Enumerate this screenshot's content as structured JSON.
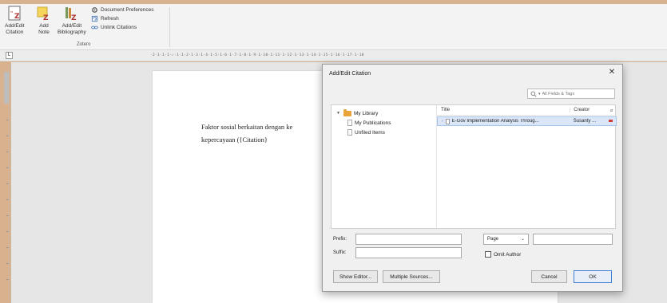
{
  "ribbon": {
    "add_edit_citation": [
      "Add/Edit",
      "Citation"
    ],
    "add_note": [
      "Add",
      "Note"
    ],
    "add_edit_bibliography": [
      "Add/Edit",
      "Bibliography"
    ],
    "document_preferences": "Document Preferences",
    "refresh": "Refresh",
    "unlink_citations": "Unlink Citations",
    "group_label": "Zotero"
  },
  "ruler": {
    "tab_selector": "L",
    "ticks": "·2·1·1·1·✓·1·1·2·1·3·1·4·1·5·1·6·1·7·1·8·1·9·1·10·1·11·1·12·1·13·1·14·1·15·1·16·1·17·1·18"
  },
  "document": {
    "line1": "Faktor sosial berkaitan dengan ke",
    "line2": "kepercayaan ({Citation}"
  },
  "dialog": {
    "title": "Add/Edit Citation",
    "close": "✕",
    "search_placeholder": "All Fields & Tags",
    "tree": {
      "root": "My Library",
      "children": [
        "My Publications",
        "Unfiled Items"
      ]
    },
    "columns": {
      "title": "Title",
      "creator": "Creator"
    },
    "items": [
      {
        "title": "E-Gov Implementation Analysis Throug...",
        "creator": "Susanty ..."
      }
    ],
    "prefix_label": "Prefix:",
    "suffix_label": "Suffix:",
    "locator_selected": "Page",
    "omit_author": "Omit Author",
    "show_editor": "Show Editor...",
    "multiple_sources": "Multiple Sources...",
    "cancel": "Cancel",
    "ok": "OK"
  },
  "colors": {
    "frame": "#d8b28f",
    "ribbon_bg": "#f3f3f3",
    "selection": "#dbe7f8",
    "folder": "#e9a33b"
  }
}
